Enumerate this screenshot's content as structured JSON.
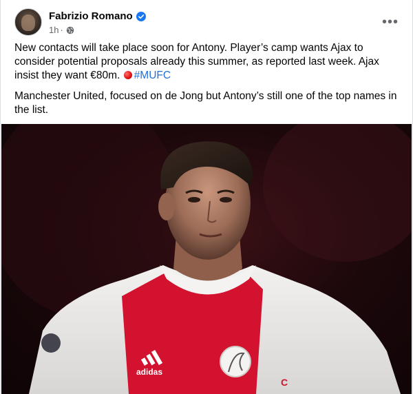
{
  "post": {
    "author": {
      "name": "Fabrizio Romano",
      "verified": true,
      "avatar_icon": "avatar-icon"
    },
    "meta": {
      "time": "1h",
      "separator": "·",
      "audience_icon": "globe-icon"
    },
    "more_label": "•••",
    "paragraphs": [
      "New contacts will take place soon for Antony. Player’s camp wants Ajax to consider potential proposals already this summer, as reported last week. Ajax insist they want €80m.",
      "Manchester United, focused on de Jong but Antony’s still one of the top names in the list."
    ],
    "hashtag": "#MUFC",
    "emoji": "red-circle",
    "image": {
      "description_icon": "player-photo",
      "kit_brand": "adidas",
      "sleeve_text": "C"
    }
  },
  "colors": {
    "accent_link": "#216fdb",
    "verified_blue": "#1877f2",
    "secondary_text": "#65676b",
    "ajax_red": "#d2122e"
  }
}
